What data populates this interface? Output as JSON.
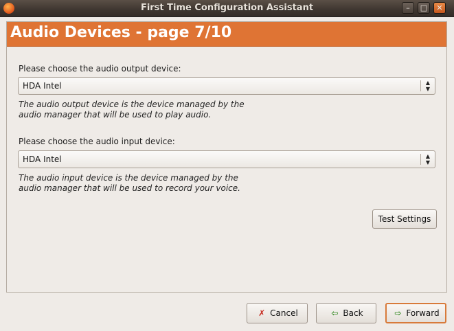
{
  "window": {
    "title": "First Time Configuration Assistant"
  },
  "page": {
    "title": "Audio Devices - page 7/10"
  },
  "output": {
    "label": "Please choose the audio output device:",
    "value": "HDA Intel",
    "hint_line1": "The audio output device is the device managed by the",
    "hint_line2": "audio manager that will be used to play audio."
  },
  "input": {
    "label": "Please choose the audio input device:",
    "value": "HDA Intel",
    "hint_line1": "The audio input device is the device managed by the",
    "hint_line2": "audio manager that will be used to record your voice."
  },
  "buttons": {
    "test": "Test Settings",
    "cancel": "Cancel",
    "back": "Back",
    "forward": "Forward"
  },
  "icons": {
    "app": "app-icon",
    "minimize": "minimize-icon",
    "maximize": "maximize-icon",
    "close": "close-icon",
    "cancel": "cancel-x-icon",
    "back": "back-arrow-icon",
    "forward": "forward-arrow-icon"
  },
  "colors": {
    "accent": "#df7434",
    "header_text": "#ffffff"
  }
}
